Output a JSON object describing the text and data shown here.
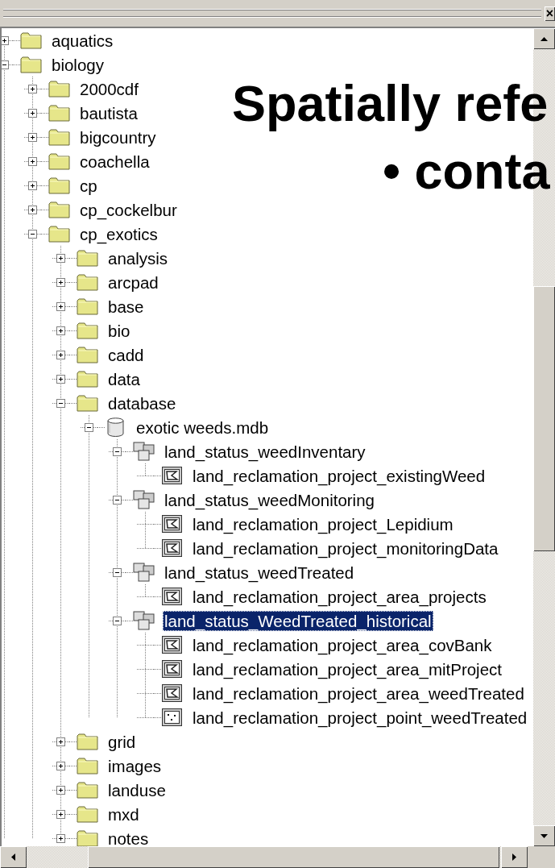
{
  "panel": {
    "close": "×"
  },
  "tree": [
    {
      "label": "aquatics",
      "kind": "folder",
      "expanded": false,
      "selected": false
    },
    {
      "label": "biology",
      "kind": "folder",
      "expanded": true,
      "selected": false,
      "children": [
        {
          "label": "2000cdf",
          "kind": "folder",
          "expanded": false,
          "selected": false
        },
        {
          "label": "bautista",
          "kind": "folder",
          "expanded": false,
          "selected": false
        },
        {
          "label": "bigcountry",
          "kind": "folder",
          "expanded": false,
          "selected": false
        },
        {
          "label": "coachella",
          "kind": "folder",
          "expanded": false,
          "selected": false
        },
        {
          "label": "cp",
          "kind": "folder",
          "expanded": false,
          "selected": false
        },
        {
          "label": "cp_cockelbur",
          "kind": "folder",
          "expanded": false,
          "selected": false
        },
        {
          "label": "cp_exotics",
          "kind": "folder",
          "expanded": true,
          "selected": false,
          "children": [
            {
              "label": "analysis",
              "kind": "folder",
              "expanded": false,
              "selected": false
            },
            {
              "label": "arcpad",
              "kind": "folder",
              "expanded": false,
              "selected": false
            },
            {
              "label": "base",
              "kind": "folder",
              "expanded": false,
              "selected": false
            },
            {
              "label": "bio",
              "kind": "folder",
              "expanded": false,
              "selected": false
            },
            {
              "label": "cadd",
              "kind": "folder",
              "expanded": false,
              "selected": false
            },
            {
              "label": "data",
              "kind": "folder",
              "expanded": false,
              "selected": false
            },
            {
              "label": "database",
              "kind": "folder",
              "expanded": true,
              "selected": false,
              "children": [
                {
                  "label": "exotic weeds.mdb",
                  "kind": "database",
                  "expanded": true,
                  "selected": false,
                  "children": [
                    {
                      "label": "land_status_weedInventary",
                      "kind": "dataset",
                      "expanded": true,
                      "selected": false,
                      "children": [
                        {
                          "label": "land_reclamation_project_existingWeed",
                          "kind": "polygon",
                          "selected": false
                        }
                      ]
                    },
                    {
                      "label": "land_status_weedMonitoring",
                      "kind": "dataset",
                      "expanded": true,
                      "selected": false,
                      "children": [
                        {
                          "label": "land_reclamation_project_Lepidium",
                          "kind": "polygon",
                          "selected": false
                        },
                        {
                          "label": "land_reclamation_project_monitoringData",
                          "kind": "polygon",
                          "selected": false
                        }
                      ]
                    },
                    {
                      "label": "land_status_weedTreated",
                      "kind": "dataset",
                      "expanded": true,
                      "selected": false,
                      "children": [
                        {
                          "label": "land_reclamation_project_area_projects",
                          "kind": "polygon",
                          "selected": false
                        }
                      ]
                    },
                    {
                      "label": "land_status_WeedTreated_historical",
                      "kind": "dataset",
                      "expanded": true,
                      "selected": true,
                      "children": [
                        {
                          "label": "land_reclamation_project_area_covBank",
                          "kind": "polygon",
                          "selected": false
                        },
                        {
                          "label": "land_reclamation_project_area_mitProject",
                          "kind": "polygon",
                          "selected": false
                        },
                        {
                          "label": "land_reclamation_project_area_weedTreated",
                          "kind": "polygon",
                          "selected": false
                        },
                        {
                          "label": "land_reclamation_project_point_weedTreated",
                          "kind": "point",
                          "selected": false
                        }
                      ]
                    }
                  ]
                }
              ]
            },
            {
              "label": "grid",
              "kind": "folder",
              "expanded": false,
              "selected": false
            },
            {
              "label": "images",
              "kind": "folder",
              "expanded": false,
              "selected": false
            },
            {
              "label": "landuse",
              "kind": "folder",
              "expanded": false,
              "selected": false
            },
            {
              "label": "mxd",
              "kind": "folder",
              "expanded": false,
              "selected": false
            },
            {
              "label": "notes",
              "kind": "folder",
              "expanded": false,
              "selected": false
            }
          ]
        }
      ]
    }
  ],
  "slide_overlay": {
    "heading": "Spatially refe",
    "bullet": "• conta"
  }
}
